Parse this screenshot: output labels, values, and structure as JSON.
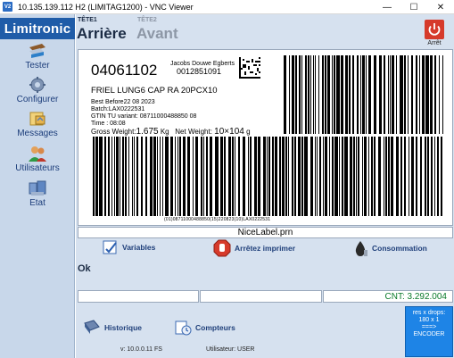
{
  "window": {
    "app_icon": "V2",
    "title": "10.135.139.112 H2 (LIMITAG1200) - VNC Viewer",
    "minimize_glyph": "—",
    "maximize_glyph": "☐",
    "close_glyph": "✕"
  },
  "sidebar": {
    "logo": "Limitronic",
    "items": [
      {
        "label": "Tester",
        "icon": "tester-icon"
      },
      {
        "label": "Configurer",
        "icon": "gear-icon"
      },
      {
        "label": "Messages",
        "icon": "messages-icon"
      },
      {
        "label": "Utilisateurs",
        "icon": "users-icon"
      },
      {
        "label": "Etat",
        "icon": "status-icon"
      }
    ]
  },
  "header": {
    "tete1": "TÊTE1",
    "tete2": "TÊTE2",
    "arriere": "Arrière",
    "avant": "Avant",
    "stop_label": "Arrêt"
  },
  "label": {
    "code": "04061102",
    "company": "Jacobs Douwe Egberts",
    "company_number": "0012851091",
    "product": "FRIEL LUNG6 CAP RA 20PCX10",
    "best_before": "Best Before22 08 2023",
    "batch": "Batch:LAX0222531",
    "gtin": "GTIN TU  variant: 08711000488850  08",
    "time": "Time : 08:08",
    "gross_weight_prefix": "Gross Weight:",
    "gross_weight_value": "1.675",
    "gross_weight_unit": "Kg",
    "net_weight_prefix": "Net Weight:",
    "net_weight_value": "10×104",
    "net_weight_unit": "g",
    "barcode_caption": "(01)08711000488850(15)220823(10)LAX0222531"
  },
  "filename": "NiceLabel.prn",
  "actions": {
    "variables": "Variables",
    "stop_print": "Arrêtez imprimer",
    "consumption": "Consommation",
    "history": "Historique",
    "counters": "Compteurs"
  },
  "status": {
    "ok": "Ok",
    "cnt": "CNT: 3.292.004"
  },
  "footer": {
    "version": "v: 10.0.0.11 FS",
    "user": "Utilisateur: USER"
  },
  "encoder": {
    "line1": "res x drops:",
    "line2": "180 x 1",
    "line3": "===>",
    "line4": "ENCODER"
  },
  "colors": {
    "sidebar_bg": "#c8d7ea",
    "main_bg": "#d6e1ef",
    "logo_bg": "#1f5ca8",
    "stop_red": "#d63a2b",
    "cnt_green": "#0a7a2a",
    "encoder_blue": "#1e84e6"
  }
}
